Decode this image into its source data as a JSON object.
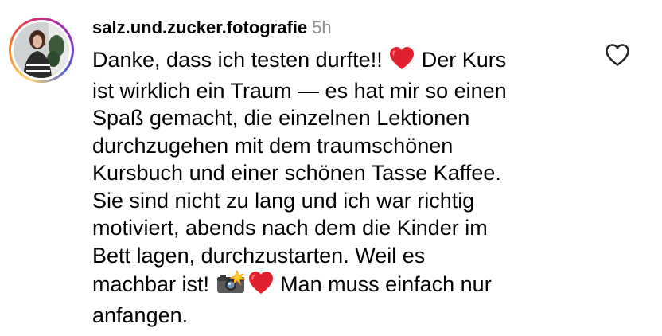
{
  "comment": {
    "username": "salz.und.zucker.fotografie",
    "time": "5h",
    "text_part1": "Danke, dass ich testen durfte!! ",
    "text_part2": " Der Kurs\nist wirklich ein Traum — es hat mir so einen\nSpaß gemacht, die einzelnen Lektionen\ndurchzugehen mit dem traumschönen\nKursbuch und einer schönen Tasse Kaffee.\nSie sind nicht zu lang und ich war richtig\nmotiviert, abends nach dem die Kinder im\nBett lagen, durchzustarten. Weil es\nmachbar ist! ",
    "text_part3": " Man muss einfach nur\nanfangen.",
    "emojis": [
      "red-heart-icon",
      "camera-flash-icon",
      "red-heart-icon"
    ],
    "like_icon": "heart-outline-icon"
  },
  "colors": {
    "text": "#000000",
    "muted": "#8e8e8e",
    "heart": "#e0222f",
    "icon": "#262626"
  }
}
